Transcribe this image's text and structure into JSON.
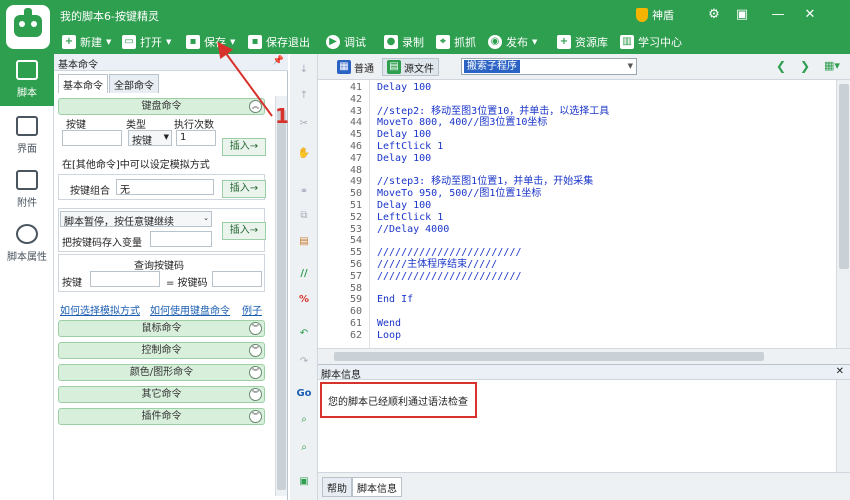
{
  "app": {
    "title": "我的脚本6-按键精灵",
    "vip_label": "神盾",
    "window_controls": [
      "gear-icon",
      "restore-icon",
      "minimize-icon",
      "close-icon"
    ]
  },
  "toolbar": {
    "new": "新建",
    "open": "打开",
    "save": "保存",
    "save_exit": "保存退出",
    "debug": "调试",
    "record": "录制",
    "capture": "抓抓",
    "publish": "发布",
    "resources": "资源库",
    "learning": "学习中心"
  },
  "rail": {
    "items": [
      {
        "label": "脚本",
        "icon": "robot-icon",
        "active": true
      },
      {
        "label": "界面",
        "icon": "window-icon",
        "active": false
      },
      {
        "label": "附件",
        "icon": "document-icon",
        "active": false
      },
      {
        "label": "脚本属性",
        "icon": "info-icon",
        "active": false
      }
    ]
  },
  "panel": {
    "title": "基本命令",
    "tabs": [
      "基本命令",
      "全部命令"
    ],
    "keyboard": {
      "header": "键盘命令",
      "col_key": "按键",
      "col_type": "类型",
      "col_times": "执行次数",
      "type_value": "按键",
      "times_value": "1",
      "insert": "插入→",
      "note": "在[其他命令]中可以设定模拟方式",
      "combo_label": "按键组合",
      "combo_value": "无",
      "pause_option": "脚本暂停，按任意键继续",
      "save_to_var": "把按键码存入变量",
      "query_title": "查询按键码",
      "query_key": "按键",
      "query_code": "= 按键码",
      "link_mode": "如何选择模拟方式",
      "link_usage": "如何使用键盘命令",
      "link_example": "例子"
    },
    "sections": [
      "鼠标命令",
      "控制命令",
      "颜色/图形命令",
      "其它命令",
      "插件命令"
    ]
  },
  "editor": {
    "view_normal": "普通",
    "view_source": "源文件",
    "proc_selected": "搬索子程序",
    "lines": [
      {
        "n": "41",
        "text": "Delay 100"
      },
      {
        "n": "42",
        "text": ""
      },
      {
        "n": "43",
        "text": "//step2: 移动至图3位置10，并单击，以选择工具"
      },
      {
        "n": "44",
        "text": "MoveTo 800, 400//图3位置10坐标"
      },
      {
        "n": "45",
        "text": "Delay 100"
      },
      {
        "n": "46",
        "text": "LeftClick 1"
      },
      {
        "n": "47",
        "text": "Delay 100"
      },
      {
        "n": "48",
        "text": ""
      },
      {
        "n": "49",
        "text": "//step3: 移动至图1位置1，并单击，开始采集"
      },
      {
        "n": "50",
        "text": "MoveTo 950, 500//图1位置1坐标"
      },
      {
        "n": "51",
        "text": "Delay 100"
      },
      {
        "n": "52",
        "text": "LeftClick 1"
      },
      {
        "n": "53",
        "text": "//Delay 4000"
      },
      {
        "n": "54",
        "text": ""
      },
      {
        "n": "55",
        "text": "////////////////////////"
      },
      {
        "n": "56",
        "text": "/////主体程序结束/////"
      },
      {
        "n": "57",
        "text": "////////////////////////"
      },
      {
        "n": "58",
        "text": ""
      },
      {
        "n": "59",
        "text": "End If"
      },
      {
        "n": "60",
        "text": ""
      },
      {
        "n": "61",
        "text": "Wend"
      },
      {
        "n": "62",
        "text": "Loop"
      }
    ]
  },
  "info": {
    "title": "脚本信息",
    "message": "您的脚本已经顺利通过语法检查"
  },
  "bottom_tabs": [
    "帮助",
    "脚本信息"
  ],
  "annotation": {
    "number": "1",
    "color": "#d8322c"
  },
  "colors": {
    "brand": "#2e9e4f",
    "highlight": "#2b63c5",
    "alert": "#d8322c"
  }
}
